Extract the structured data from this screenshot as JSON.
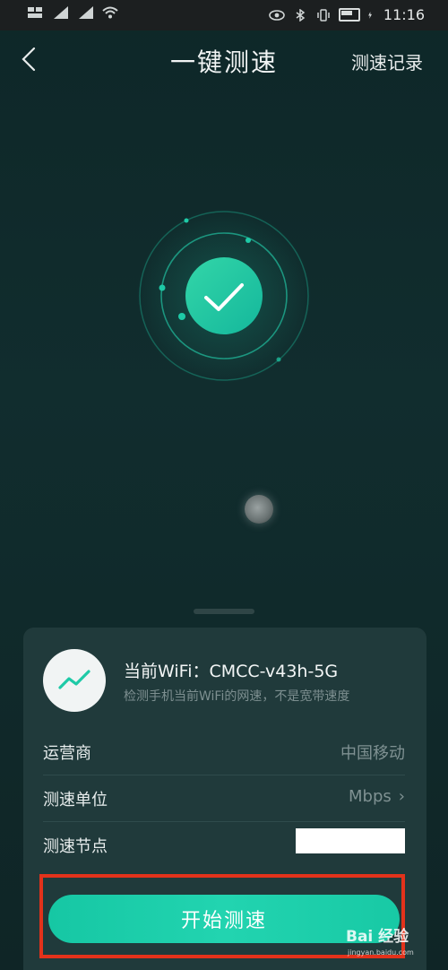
{
  "status_bar": {
    "time": "11:16",
    "icons": [
      "notification-icon",
      "sim-signal-icon",
      "sim-signal-icon",
      "wifi-icon",
      "eye-icon",
      "bluetooth-icon",
      "vibrate-icon",
      "battery-icon",
      "charging-icon"
    ]
  },
  "header": {
    "title": "一键测速",
    "right_link": "测速记录",
    "back_icon": "chevron-left-icon"
  },
  "wifi": {
    "title": "当前WiFi：CMCC-v43h-5G",
    "subtitle": "检测手机当前WiFi的网速，不是宽带速度",
    "icon": "trend-line-icon"
  },
  "info": {
    "operator_label": "运营商",
    "operator_value": "中国移动",
    "unit_label": "测速单位",
    "unit_value": "Mbps",
    "node_label": "测速节点",
    "node_value": ""
  },
  "actions": {
    "start_label": "开始测速"
  },
  "watermark": {
    "main": "Bai 经验",
    "sub": "jingyan.baidu.com"
  },
  "colors": {
    "accent": "#1ecaa7",
    "highlight_frame": "#e3321b",
    "sheet_bg": "#203a3b",
    "page_bg": "#0f2a2b"
  }
}
